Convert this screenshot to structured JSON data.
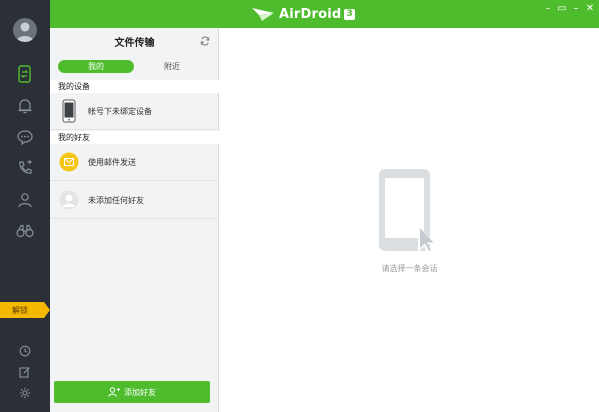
{
  "app": {
    "name": "AirDroid",
    "version_badge": "3"
  },
  "window_controls": [
    "–",
    "▭",
    "–",
    "✕"
  ],
  "sidebar": {
    "nav_items": [
      {
        "name": "file-transfer",
        "icon": "phone-transfer-icon",
        "active": true
      },
      {
        "name": "notifications",
        "icon": "bell-icon",
        "active": false
      },
      {
        "name": "messages",
        "icon": "chat-bubble-icon",
        "active": false
      },
      {
        "name": "calls",
        "icon": "phone-call-icon",
        "active": false
      },
      {
        "name": "contacts",
        "icon": "person-icon",
        "active": false
      },
      {
        "name": "find-phone",
        "icon": "binoculars-icon",
        "active": false
      }
    ],
    "unlock_label": "解锁",
    "bottom_items": [
      {
        "name": "history",
        "icon": "clock-icon"
      },
      {
        "name": "edit",
        "icon": "edit-icon"
      },
      {
        "name": "settings",
        "icon": "gear-icon"
      }
    ]
  },
  "panel": {
    "title": "文件传输",
    "tabs": [
      {
        "label": "我的",
        "active": true
      },
      {
        "label": "附近",
        "active": false
      }
    ],
    "my_devices_header": "我的设备",
    "device_item_label": "帐号下未绑定设备",
    "my_friends_header": "我的好友",
    "email_item_label": "使用邮件发送",
    "friend_item_label": "未添加任何好友",
    "add_friend_label": "添加好友"
  },
  "main": {
    "placeholder_text": "请选择一条会话"
  },
  "colors": {
    "brand_green": "#4fbc2e",
    "sidebar_dark": "#2b3036",
    "unlock_yellow": "#f5b800",
    "email_yellow": "#f5c518"
  }
}
